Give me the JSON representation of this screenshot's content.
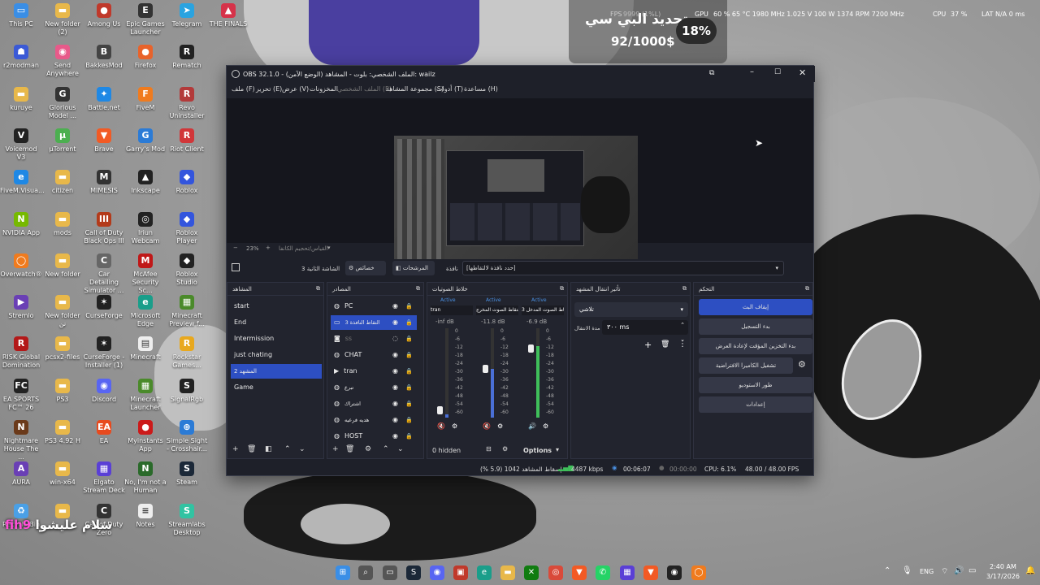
{
  "desktop_icons": [
    {
      "label": "This PC",
      "color": "#3a8ee6",
      "glyph": "▭",
      "col": 0,
      "row": 0
    },
    {
      "label": "New folder (2)",
      "color": "#e8b84a",
      "glyph": "▬",
      "col": 1,
      "row": 0
    },
    {
      "label": "Among Us",
      "color": "#c0392b",
      "glyph": "●",
      "col": 2,
      "row": 0
    },
    {
      "label": "Epic Games Launcher",
      "color": "#333333",
      "glyph": "E",
      "col": 3,
      "row": 0
    },
    {
      "label": "Telegram",
      "color": "#2aa3e0",
      "glyph": "➤",
      "col": 4,
      "row": 0
    },
    {
      "label": "THE FINALS",
      "color": "#d6334a",
      "glyph": "▲",
      "col": 5,
      "row": 0
    },
    {
      "label": "r2modman",
      "color": "#3b5ad6",
      "glyph": "☗",
      "col": 0,
      "row": 1
    },
    {
      "label": "Send Anywhere",
      "color": "#e85a8a",
      "glyph": "◉",
      "col": 1,
      "row": 1
    },
    {
      "label": "BakkesMod",
      "color": "#444444",
      "glyph": "B",
      "col": 2,
      "row": 1
    },
    {
      "label": "Firefox",
      "color": "#e8632b",
      "glyph": "●",
      "col": 3,
      "row": 1
    },
    {
      "label": "Rematch",
      "color": "#222222",
      "glyph": "R",
      "col": 4,
      "row": 1
    },
    {
      "label": "kuruye",
      "color": "#e8b84a",
      "glyph": "▬",
      "col": 0,
      "row": 2
    },
    {
      "label": "Glorious Model ...",
      "color": "#333333",
      "glyph": "G",
      "col": 1,
      "row": 2
    },
    {
      "label": "Battle.net",
      "color": "#1e88e5",
      "glyph": "✦",
      "col": 2,
      "row": 2
    },
    {
      "label": "FiveM",
      "color": "#f07b1e",
      "glyph": "F",
      "col": 3,
      "row": 2
    },
    {
      "label": "Revo Uninstaller",
      "color": "#b33a3a",
      "glyph": "R",
      "col": 4,
      "row": 2
    },
    {
      "label": "Voicemod V3",
      "color": "#222222",
      "glyph": "V",
      "col": 0,
      "row": 3
    },
    {
      "label": "µTorrent",
      "color": "#4caf50",
      "glyph": "µ",
      "col": 1,
      "row": 3
    },
    {
      "label": "Brave",
      "color": "#f25a24",
      "glyph": "▼",
      "col": 2,
      "row": 3
    },
    {
      "label": "Garry's Mod",
      "color": "#2b7bd6",
      "glyph": "G",
      "col": 3,
      "row": 3
    },
    {
      "label": "Riot Client",
      "color": "#d13639",
      "glyph": "R",
      "col": 4,
      "row": 3
    },
    {
      "label": "FiveM.Visua...",
      "color": "#1e88e5",
      "glyph": "e",
      "col": 0,
      "row": 4
    },
    {
      "label": "citizen",
      "color": "#e8b84a",
      "glyph": "▬",
      "col": 1,
      "row": 4
    },
    {
      "label": "MIMESIS",
      "color": "#333333",
      "glyph": "M",
      "col": 2,
      "row": 4
    },
    {
      "label": "Inkscape",
      "color": "#222222",
      "glyph": "▲",
      "col": 3,
      "row": 4
    },
    {
      "label": "Roblox",
      "color": "#3355dd",
      "glyph": "◆",
      "col": 4,
      "row": 4
    },
    {
      "label": "NVIDIA App",
      "color": "#76b900",
      "glyph": "N",
      "col": 0,
      "row": 5
    },
    {
      "label": "mods",
      "color": "#e8b84a",
      "glyph": "▬",
      "col": 1,
      "row": 5
    },
    {
      "label": "Call of Duty Black Ops III",
      "color": "#b33a1a",
      "glyph": "III",
      "col": 2,
      "row": 5
    },
    {
      "label": "Iriun Webcam",
      "color": "#222222",
      "glyph": "◎",
      "col": 3,
      "row": 5
    },
    {
      "label": "Roblox Player",
      "color": "#3355dd",
      "glyph": "◆",
      "col": 4,
      "row": 5
    },
    {
      "label": "Overwatch®",
      "color": "#f07b1e",
      "glyph": "◯",
      "col": 0,
      "row": 6
    },
    {
      "label": "New folder",
      "color": "#e8b84a",
      "glyph": "▬",
      "col": 1,
      "row": 6
    },
    {
      "label": "Car Detailing Simulator ...",
      "color": "#666666",
      "glyph": "C",
      "col": 2,
      "row": 6
    },
    {
      "label": "McAfee Security Sc...",
      "color": "#c01818",
      "glyph": "M",
      "col": 3,
      "row": 6
    },
    {
      "label": "Roblox Studio",
      "color": "#222222",
      "glyph": "◆",
      "col": 4,
      "row": 6
    },
    {
      "label": "Stremio",
      "color": "#6a3fb5",
      "glyph": "▶",
      "col": 0,
      "row": 7
    },
    {
      "label": "New folder نن",
      "color": "#e8b84a",
      "glyph": "▬",
      "col": 1,
      "row": 7
    },
    {
      "label": "CurseForge",
      "color": "#222222",
      "glyph": "✶",
      "col": 2,
      "row": 7
    },
    {
      "label": "Microsoft Edge",
      "color": "#1a9e8a",
      "glyph": "e",
      "col": 3,
      "row": 7
    },
    {
      "label": "Minecraft Preview f...",
      "color": "#4a8a2a",
      "glyph": "▦",
      "col": 4,
      "row": 7
    },
    {
      "label": "RISK Global Domination",
      "color": "#b31919",
      "glyph": "R",
      "col": 0,
      "row": 8
    },
    {
      "label": "pcsx2-files",
      "color": "#e8b84a",
      "glyph": "▬",
      "col": 1,
      "row": 8
    },
    {
      "label": "CurseForge - Installer (1)",
      "color": "#222222",
      "glyph": "✶",
      "col": 2,
      "row": 8
    },
    {
      "label": "Minecraft",
      "color": "#eeeeee",
      "glyph": "▤",
      "col": 3,
      "row": 8
    },
    {
      "label": "Rockstar Games...",
      "color": "#e8a81e",
      "glyph": "R",
      "col": 4,
      "row": 8
    },
    {
      "label": "EA SPORTS FC™ 26",
      "color": "#222222",
      "glyph": "FC",
      "col": 0,
      "row": 9
    },
    {
      "label": "PS3",
      "color": "#e8b84a",
      "glyph": "▬",
      "col": 1,
      "row": 9
    },
    {
      "label": "Discord",
      "color": "#5865f2",
      "glyph": "◉",
      "col": 2,
      "row": 9
    },
    {
      "label": "Minecraft Launcher",
      "color": "#4a8a2a",
      "glyph": "▦",
      "col": 3,
      "row": 9
    },
    {
      "label": "SignalRgb",
      "color": "#222222",
      "glyph": "S",
      "col": 4,
      "row": 9
    },
    {
      "label": "Nightmare House The ...",
      "color": "#6b3a1a",
      "glyph": "N",
      "col": 0,
      "row": 10
    },
    {
      "label": "PS3 4.92 H",
      "color": "#e8b84a",
      "glyph": "▬",
      "col": 1,
      "row": 10
    },
    {
      "label": "EA",
      "color": "#e84a1e",
      "glyph": "EA",
      "col": 2,
      "row": 10
    },
    {
      "label": "Myinstants App",
      "color": "#cc1a1a",
      "glyph": "●",
      "col": 3,
      "row": 10
    },
    {
      "label": "Simple Sight - Crosshair...",
      "color": "#2b7bd6",
      "glyph": "⊕",
      "col": 4,
      "row": 10
    },
    {
      "label": "AURA",
      "color": "#6a3fb5",
      "glyph": "A",
      "col": 0,
      "row": 11
    },
    {
      "label": "win-x64",
      "color": "#e8b84a",
      "glyph": "▬",
      "col": 1,
      "row": 11
    },
    {
      "label": "Elgato Stream Deck",
      "color": "#5a3fd6",
      "glyph": "▦",
      "col": 2,
      "row": 11
    },
    {
      "label": "No, I'm not a Human",
      "color": "#2a6a2a",
      "glyph": "N",
      "col": 3,
      "row": 11
    },
    {
      "label": "Steam",
      "color": "#1b2838",
      "glyph": "S",
      "col": 4,
      "row": 11
    },
    {
      "label": "Recycle Bin",
      "color": "#4aa0e6",
      "glyph": "♻",
      "col": 0,
      "row": 12
    },
    {
      "label": "",
      "color": "#e8b84a",
      "glyph": "▬",
      "col": 1,
      "row": 12
    },
    {
      "label": "Call of Duty Zero",
      "color": "#333333",
      "glyph": "C",
      "col": 2,
      "row": 12
    },
    {
      "label": "Notes",
      "color": "#eeeeee",
      "glyph": "≡",
      "col": 3,
      "row": 12
    },
    {
      "label": "Streamlabs Desktop",
      "color": "#31c3a2",
      "glyph": "S",
      "col": 4,
      "row": 12
    }
  ],
  "hud": {
    "fps": "FPS",
    "fps_val": "9999 (1%L)",
    "gpu": "GPU",
    "gpu_val": "60 % 65 °C 1980 MHz 1.025 V 100 W 1374 RPM 7200 MHz",
    "cpu": "CPU",
    "cpu_val": "37 %",
    "lat": "LAT",
    "lat_val": "N/A  0 ms"
  },
  "donation": {
    "title": "تجديد البي سي",
    "amount": "92/1000$",
    "percent": "18%"
  },
  "obs": {
    "title": "OBS 32.1.0 - الملف الشخصي: بلوت - المشاهد (الوضع الآمن): wailz",
    "menu": [
      "ملف (F)",
      "تحرير (E)",
      "عرض (V)",
      "المخزونات",
      "الملف الشخصي (P)",
      "مجموعة المشاهد (S)",
      "أدوات (T)",
      "مساعدة (H)"
    ],
    "zoom": "23%",
    "zoom_hint": "القياس/تحجيم الكانفا",
    "scene_name": "الشاشة الثانية 3",
    "properties": "خصائص",
    "filters": "المرشحات",
    "window_label": "نافذة",
    "window_placeholder": "[حدد نافذة لالتقاطها]",
    "docks": {
      "scenes": {
        "title": "المشاهد",
        "items": [
          "start",
          "End",
          "Intermission",
          "just chating",
          "المشهد 2",
          "Game"
        ],
        "selected": 4
      },
      "sources": {
        "title": "المصادر",
        "items": [
          {
            "icon": "globe",
            "name": "PC"
          },
          {
            "icon": "monitor",
            "name": "التقاط النافذة 3",
            "selected": true
          },
          {
            "icon": "camera",
            "name": "ss",
            "hidden": true
          },
          {
            "icon": "globe",
            "name": "CHAT"
          },
          {
            "icon": "play",
            "name": "tran"
          },
          {
            "icon": "globe",
            "name": "تبرع"
          },
          {
            "icon": "globe",
            "name": "اشتراك"
          },
          {
            "icon": "globe",
            "name": "هديه فرعيه"
          },
          {
            "icon": "globe",
            "name": "HOST"
          }
        ]
      },
      "mixer": {
        "title": "خلاط الصوتيات",
        "active": "Active",
        "channels": [
          {
            "name": "tran",
            "db": "-inf dB",
            "level": 0.04
          },
          {
            "name": "التقاط الصوت المخرج",
            "db": "-11.8 dB",
            "level": 0.55
          },
          {
            "name": "التقاط الصوت المدخل 3",
            "db": "-6.9 dB",
            "level": 0.8
          }
        ],
        "scale": [
          "0",
          "-6",
          "-12",
          "-18",
          "-24",
          "-30",
          "-36",
          "-42",
          "-48",
          "-54",
          "-60"
        ],
        "hidden": "0 hidden",
        "options": "Options"
      },
      "transitions": {
        "title": "تأثير انتقال المشهد",
        "type": "تلاشي",
        "duration_label": "مدة الانتقال",
        "duration": "٣٠٠ ms"
      },
      "controls": {
        "title": "التحكم",
        "buttons": [
          "إيقاف البث",
          "بدء التسجيل",
          "بدء التخزين المؤقت لإعادة العرض",
          "تشغيل الكاميرا الافتراضية",
          "طور الاستوديو",
          "إعدادات"
        ]
      }
    },
    "status": {
      "dropped": "إسقاط المشاهد 1042 (5.9 %)",
      "bitrate": "4487 kbps",
      "stream_time": "00:06:07",
      "rec_time": "00:00:00",
      "cpu": "CPU: 6.1%",
      "fps": "48.00 / 48.00 FPS"
    }
  },
  "watermark": {
    "handle": "fih9",
    "name": "سلام عليشوا"
  },
  "taskbar": {
    "lang": "ENG",
    "time": "2:40 AM",
    "date": "3/17/2026",
    "badge_count": "9+"
  },
  "colors": {
    "obs_bg": "#1e2029",
    "accent": "#2d4fc2",
    "selected": "#2d4fc2"
  }
}
